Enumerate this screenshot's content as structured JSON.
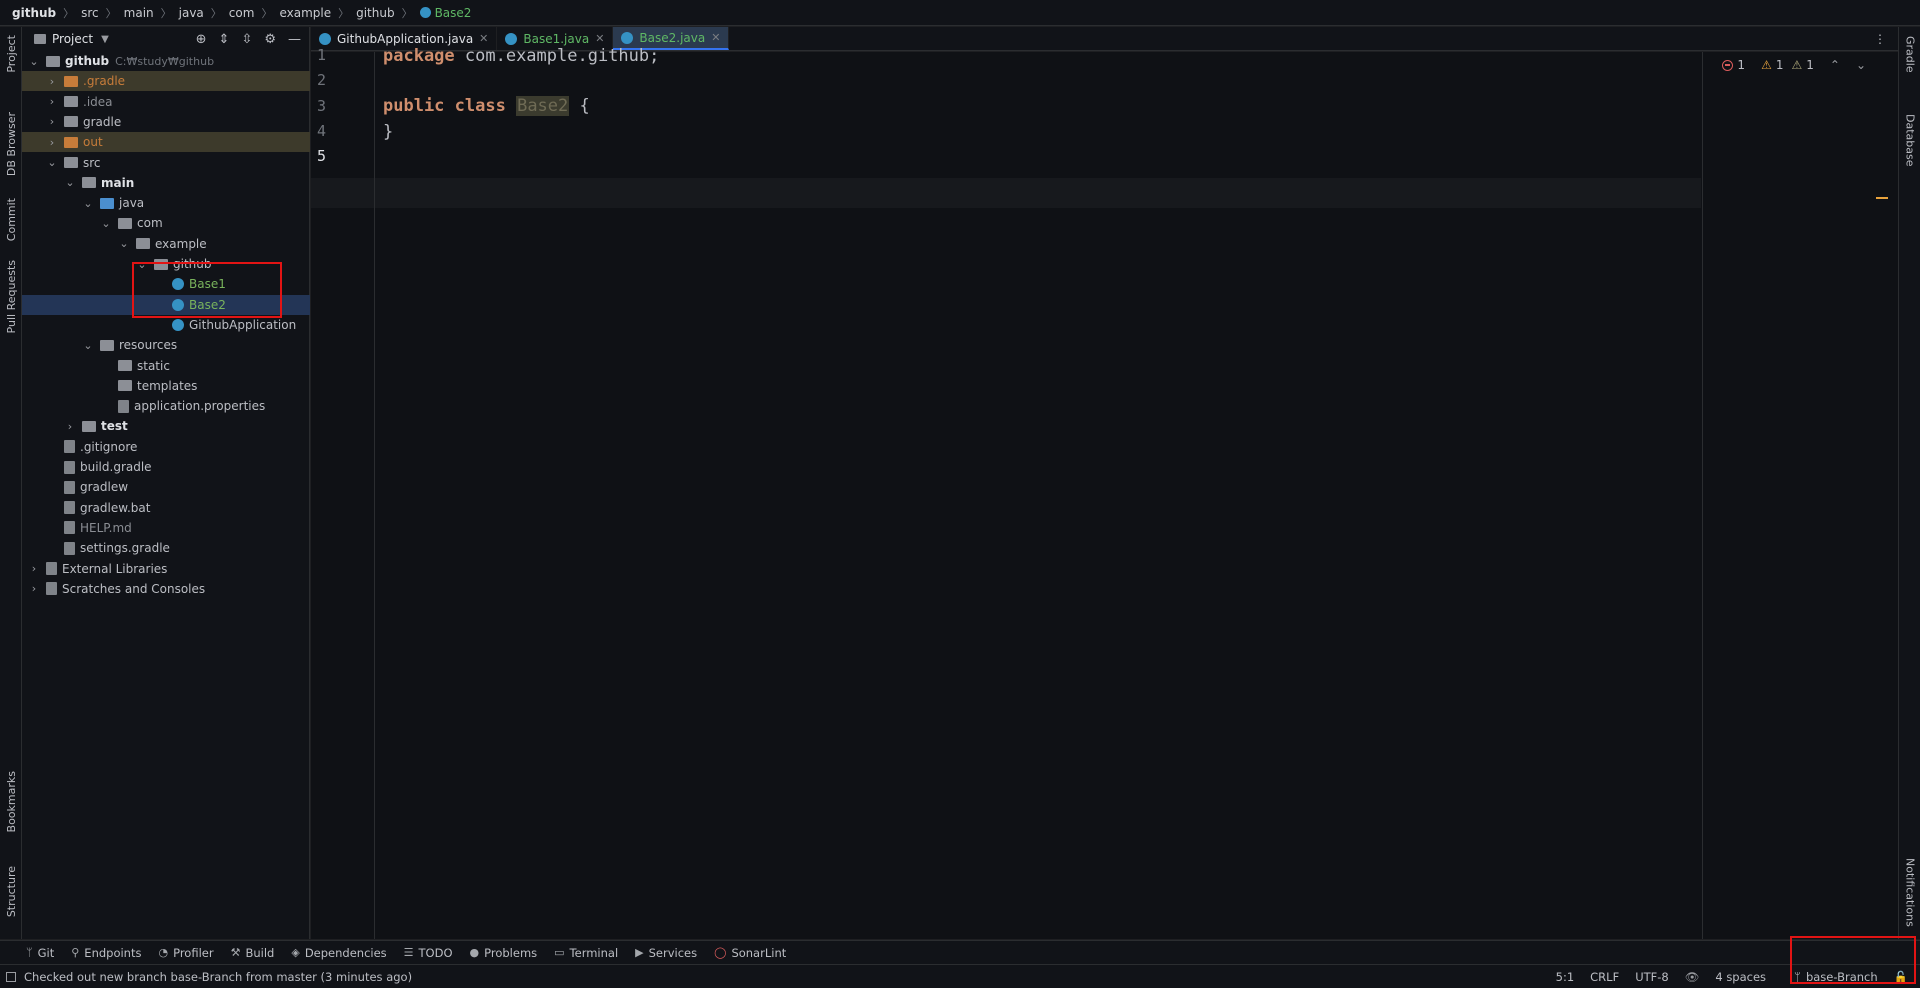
{
  "breadcrumbs": [
    "github",
    "src",
    "main",
    "java",
    "com",
    "example",
    "github",
    "Base2"
  ],
  "left_strip": [
    "Project",
    "DB Browser",
    "Commit",
    "Pull Requests",
    "Bookmarks",
    "Structure"
  ],
  "right_strip": [
    "Gradle",
    "Database",
    "Notifications"
  ],
  "project_panel": {
    "title": "Project",
    "tree": [
      {
        "label": "github",
        "extra": "C:₩study₩github",
        "depth": 0,
        "arrow": "down",
        "icon": "folder",
        "style": "bold"
      },
      {
        "label": ".gradle",
        "depth": 1,
        "arrow": "right",
        "icon": "folder-orange",
        "style": "orange",
        "highlight": true
      },
      {
        "label": ".idea",
        "depth": 1,
        "arrow": "right",
        "icon": "folder",
        "style": "gray"
      },
      {
        "label": "gradle",
        "depth": 1,
        "arrow": "right",
        "icon": "folder",
        "style": "normal"
      },
      {
        "label": "out",
        "depth": 1,
        "arrow": "right",
        "icon": "folder-orange",
        "style": "orange",
        "highlight": true
      },
      {
        "label": "src",
        "depth": 1,
        "arrow": "down",
        "icon": "folder",
        "style": "normal"
      },
      {
        "label": "main",
        "depth": 2,
        "arrow": "down",
        "icon": "folder",
        "style": "bold"
      },
      {
        "label": "java",
        "depth": 3,
        "arrow": "down",
        "icon": "folder-blue",
        "style": "normal"
      },
      {
        "label": "com",
        "depth": 4,
        "arrow": "down",
        "icon": "package",
        "style": "normal"
      },
      {
        "label": "example",
        "depth": 5,
        "arrow": "down",
        "icon": "package",
        "style": "normal"
      },
      {
        "label": "github",
        "depth": 6,
        "arrow": "down",
        "icon": "package",
        "style": "normal"
      },
      {
        "label": "Base1",
        "depth": 7,
        "arrow": "",
        "icon": "class",
        "style": "green"
      },
      {
        "label": "Base2",
        "depth": 7,
        "arrow": "",
        "icon": "class",
        "style": "green",
        "selected": true
      },
      {
        "label": "GithubApplication",
        "depth": 7,
        "arrow": "",
        "icon": "class",
        "style": "normal"
      },
      {
        "label": "resources",
        "depth": 3,
        "arrow": "down",
        "icon": "folder",
        "style": "normal"
      },
      {
        "label": "static",
        "depth": 4,
        "arrow": "",
        "icon": "folder",
        "style": "normal"
      },
      {
        "label": "templates",
        "depth": 4,
        "arrow": "",
        "icon": "folder",
        "style": "normal"
      },
      {
        "label": "application.properties",
        "depth": 4,
        "arrow": "",
        "icon": "file",
        "style": "normal"
      },
      {
        "label": "test",
        "depth": 2,
        "arrow": "right",
        "icon": "folder",
        "style": "bold"
      },
      {
        "label": ".gitignore",
        "depth": 1,
        "arrow": "",
        "icon": "file",
        "style": "normal"
      },
      {
        "label": "build.gradle",
        "depth": 1,
        "arrow": "",
        "icon": "file",
        "style": "normal"
      },
      {
        "label": "gradlew",
        "depth": 1,
        "arrow": "",
        "icon": "file",
        "style": "normal"
      },
      {
        "label": "gradlew.bat",
        "depth": 1,
        "arrow": "",
        "icon": "file",
        "style": "normal"
      },
      {
        "label": "HELP.md",
        "depth": 1,
        "arrow": "",
        "icon": "file",
        "style": "gray"
      },
      {
        "label": "settings.gradle",
        "depth": 1,
        "arrow": "",
        "icon": "file",
        "style": "normal"
      },
      {
        "label": "External Libraries",
        "depth": 0,
        "arrow": "right",
        "icon": "library",
        "style": "normal"
      },
      {
        "label": "Scratches and Consoles",
        "depth": 0,
        "arrow": "right",
        "icon": "scratch",
        "style": "normal"
      }
    ]
  },
  "tabs": [
    {
      "label": "GithubApplication.java",
      "style": "white",
      "active": false
    },
    {
      "label": "Base1.java",
      "style": "green",
      "active": false
    },
    {
      "label": "Base2.java",
      "style": "green",
      "active": true
    }
  ],
  "editor": {
    "lines": [
      "1",
      "2",
      "3",
      "4",
      "5"
    ],
    "code": {
      "l1_kw": "package",
      "l1_rest": " com.example.github;",
      "l3_kw": "public class",
      "l3_name": "Base2",
      "l3_rest": " {",
      "l4": "}"
    },
    "inspections": {
      "errors": "1",
      "warnings": "1",
      "weak": "1"
    }
  },
  "tool_windows": [
    {
      "label": "Git",
      "icon": "git-icon"
    },
    {
      "label": "Endpoints",
      "icon": "endpoints-icon"
    },
    {
      "label": "Profiler",
      "icon": "profiler-icon"
    },
    {
      "label": "Build",
      "icon": "build-icon"
    },
    {
      "label": "Dependencies",
      "icon": "dependencies-icon"
    },
    {
      "label": "TODO",
      "icon": "todo-icon"
    },
    {
      "label": "Problems",
      "icon": "problems-icon"
    },
    {
      "label": "Terminal",
      "icon": "terminal-icon"
    },
    {
      "label": "Services",
      "icon": "services-icon"
    },
    {
      "label": "SonarLint",
      "icon": "sonarlint-icon"
    }
  ],
  "status": {
    "message": "Checked out new branch base-Branch from master (3 minutes ago)",
    "position": "5:1",
    "line_sep": "CRLF",
    "encoding": "UTF-8",
    "indent": "4 spaces",
    "branch": "base-Branch"
  },
  "colors": {
    "accent": "#3574f0",
    "annotation": "#e21414",
    "keyword": "#cf8e6d",
    "vcs_added": "#5fb865"
  }
}
